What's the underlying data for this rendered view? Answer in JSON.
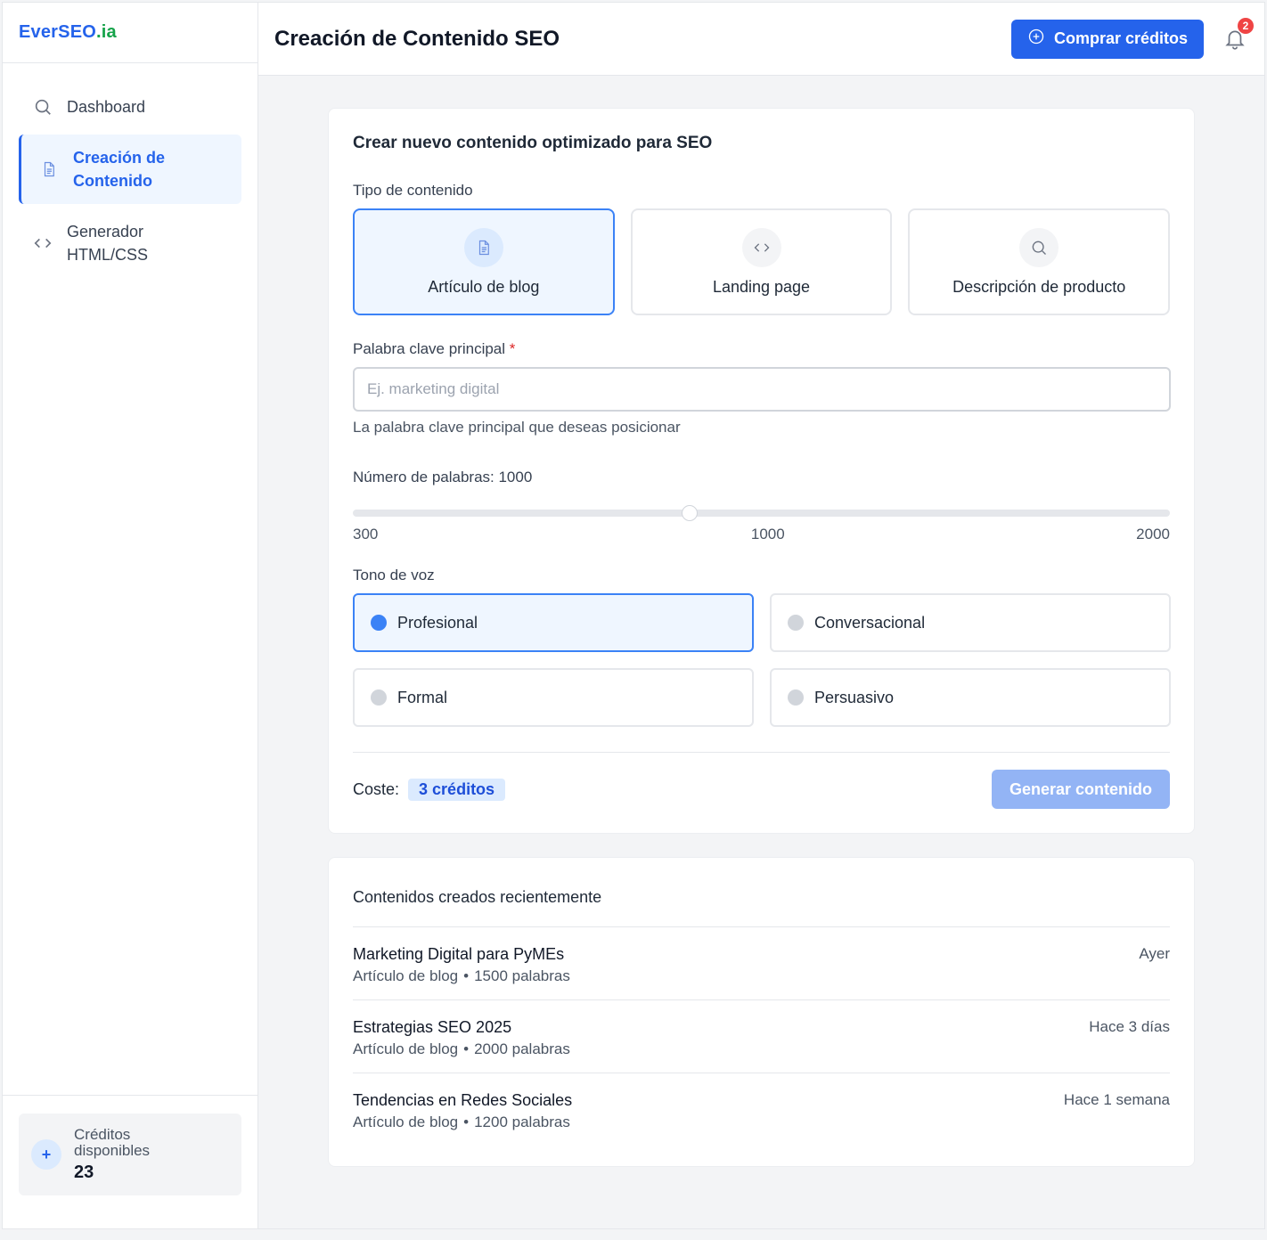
{
  "brand": {
    "part1": "EverSEO",
    "part2": ".ia"
  },
  "sidebar": {
    "items": [
      {
        "label": "Dashboard",
        "icon": "search-icon"
      },
      {
        "label": "Creación de Contenido",
        "icon": "document-icon"
      },
      {
        "label": "Generador HTML/CSS",
        "icon": "code-icon"
      }
    ],
    "credits_label": "Créditos disponibles",
    "credits_value": "23",
    "credits_icon": "plus"
  },
  "header": {
    "title": "Creación de Contenido SEO",
    "buy_label": "Comprar créditos",
    "notifications": "2"
  },
  "form": {
    "title": "Crear nuevo contenido optimizado para SEO",
    "type_label": "Tipo de contenido",
    "types": [
      {
        "label": "Artículo de blog",
        "icon": "document-icon",
        "selected": true
      },
      {
        "label": "Landing page",
        "icon": "code-icon",
        "selected": false
      },
      {
        "label": "Descripción de producto",
        "icon": "search-icon",
        "selected": false
      }
    ],
    "keyword_label": "Palabra clave principal",
    "keyword_required": "*",
    "keyword_placeholder": "Ej. marketing digital",
    "keyword_value": "",
    "keyword_help": "La palabra clave principal que deseas posicionar",
    "words_label": "Número de palabras: 1000",
    "words_min": "300",
    "words_mid": "1000",
    "words_max": "2000",
    "words_value": 1000,
    "tone_label": "Tono de voz",
    "tones": [
      {
        "label": "Profesional",
        "selected": true
      },
      {
        "label": "Conversacional",
        "selected": false
      },
      {
        "label": "Formal",
        "selected": false
      },
      {
        "label": "Persuasivo",
        "selected": false
      }
    ],
    "cost_label": "Coste:",
    "cost_value": "3 créditos",
    "generate_label": "Generar contenido"
  },
  "recent": {
    "title": "Contenidos creados recientemente",
    "separator": "•",
    "items": [
      {
        "title": "Marketing Digital para PyMEs",
        "type": "Artículo de blog",
        "words": "1500 palabras",
        "time": "Ayer"
      },
      {
        "title": "Estrategias SEO 2025",
        "type": "Artículo de blog",
        "words": "2000 palabras",
        "time": "Hace 3 días"
      },
      {
        "title": "Tendencias en Redes Sociales",
        "type": "Artículo de blog",
        "words": "1200 palabras",
        "time": "Hace 1 semana"
      }
    ]
  },
  "colors": {
    "accent": "#2563eb",
    "brand_green": "#16a34a",
    "badge_red": "#ef4444",
    "selected_bg": "#eff6ff"
  }
}
